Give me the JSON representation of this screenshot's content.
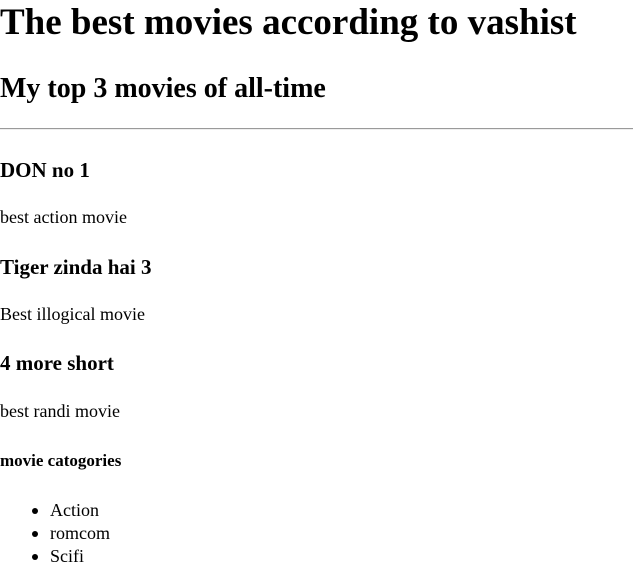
{
  "page": {
    "title": "The best movies according to vashist",
    "subtitle": "My top 3 movies of all-time"
  },
  "movies": [
    {
      "name": "DON no 1",
      "description": "best action movie"
    },
    {
      "name": "Tiger zinda hai 3",
      "description": "Best illogical movie"
    },
    {
      "name": "4 more short",
      "description": "best randi movie"
    }
  ],
  "categories": {
    "heading": "movie catogories",
    "items": [
      "Action",
      "romcom",
      "Scifi"
    ]
  }
}
